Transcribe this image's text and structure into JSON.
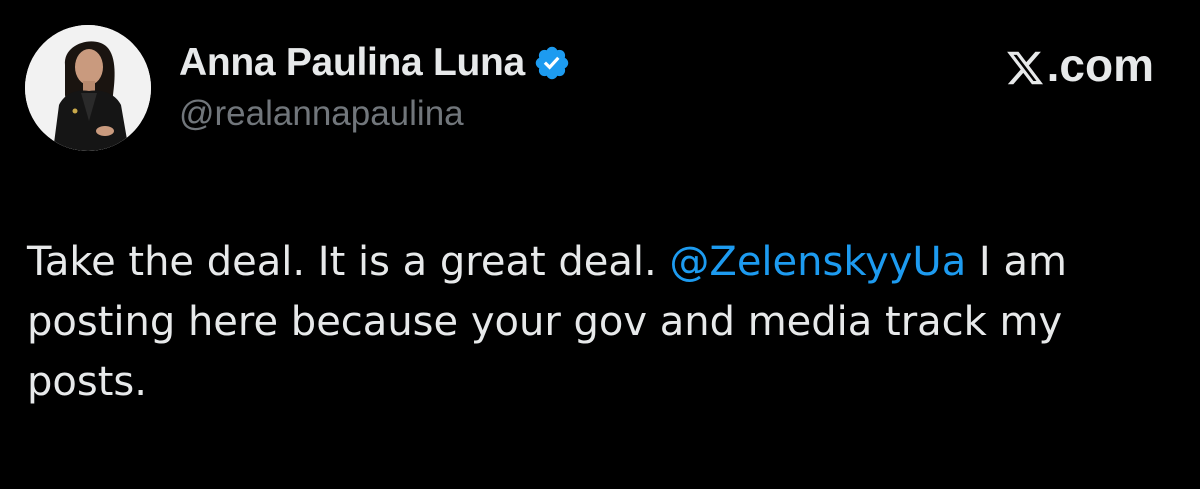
{
  "author": {
    "display_name": "Anna Paulina Luna",
    "handle": "@realannapaulina",
    "verified": true,
    "avatar_icon": "profile-photo"
  },
  "brand": {
    "label": ".com",
    "logo_icon": "x-logo-icon"
  },
  "tweet": {
    "text_before": "Take the deal. It is a great deal. ",
    "mention": "@ZelenskyyUa",
    "text_after": " I am posting here because your gov and media track my posts."
  },
  "colors": {
    "background": "#000000",
    "text": "#e7e9ea",
    "secondary_text": "#71767b",
    "mention": "#1d9bf0",
    "verified_badge": "#1d9bf0"
  }
}
